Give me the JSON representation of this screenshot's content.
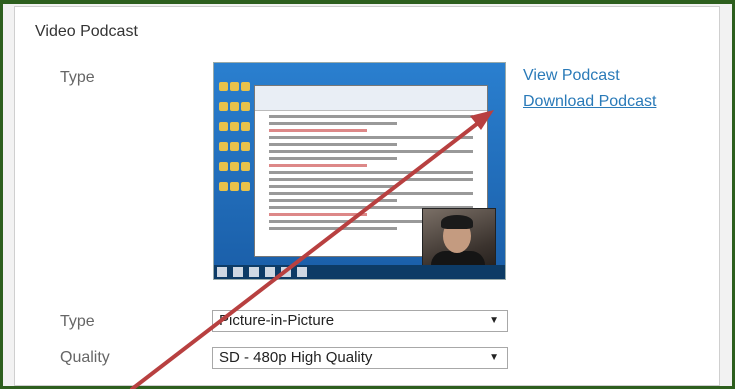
{
  "section": {
    "title": "Video Podcast"
  },
  "labels": {
    "type": "Type",
    "type2": "Type",
    "quality": "Quality"
  },
  "links": {
    "view": "View Podcast",
    "download": "Download Podcast"
  },
  "selects": {
    "type_value": "Picture-in-Picture",
    "quality_value": "SD - 480p High Quality"
  },
  "icons": {
    "dropdown": "▼",
    "annotation": "red-arrow"
  },
  "colors": {
    "frame": "#2d5f1e",
    "link": "#2a7ab8",
    "arrow": "#b84040"
  }
}
